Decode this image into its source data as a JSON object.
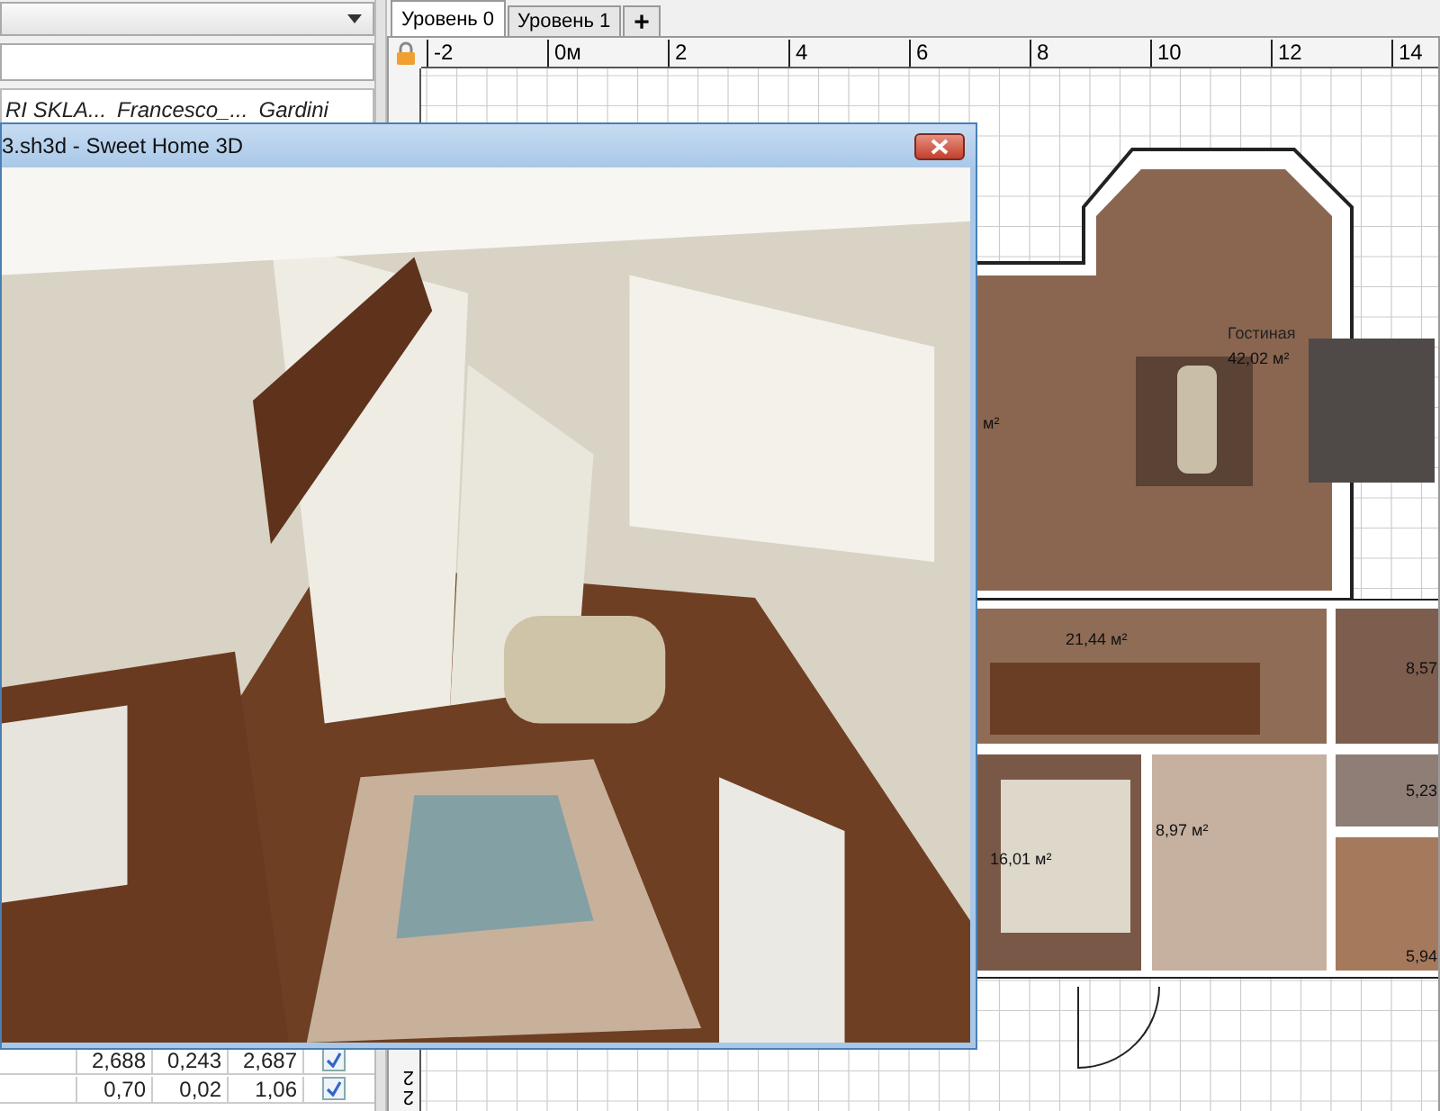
{
  "left_panel": {
    "columns": [
      "RI SKLA...",
      "Francesco_...",
      "Gardini"
    ],
    "rows": [
      {
        "values": [
          "2,688",
          "0,243",
          "2,687"
        ],
        "checked": true
      },
      {
        "values": [
          "0,70",
          "0,02",
          "1,06"
        ],
        "checked": true
      }
    ]
  },
  "plan": {
    "tabs": [
      {
        "label": "Уровень 0",
        "selected": true,
        "kind": "level"
      },
      {
        "label": "Уровень 1",
        "selected": false,
        "kind": "level"
      },
      {
        "label": "+",
        "selected": false,
        "kind": "add"
      }
    ],
    "ruler_marks": [
      "-2",
      "0м",
      "2",
      "4",
      "6",
      "8",
      "10",
      "12",
      "14"
    ],
    "vertical_ruler_marks": [
      "22"
    ],
    "rooms": [
      {
        "name": "Гостиная",
        "area": "42,02 м²"
      },
      {
        "area": "м²"
      },
      {
        "area": "21,44 м²"
      },
      {
        "area": "8,57"
      },
      {
        "area": "5,23"
      },
      {
        "area": "16,01 м²"
      },
      {
        "area": "8,97 м²"
      },
      {
        "area": "5,94"
      }
    ]
  },
  "window_3d": {
    "title": "3.sh3d - Sweet Home 3D"
  }
}
